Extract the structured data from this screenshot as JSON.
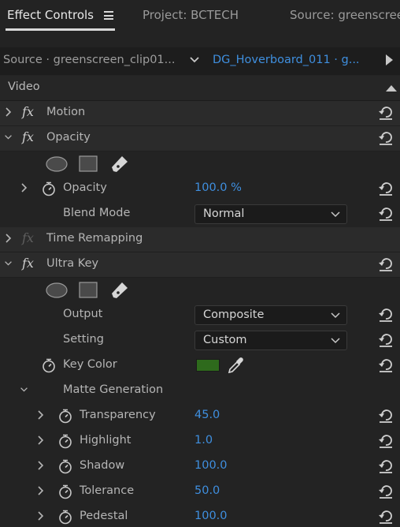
{
  "tabs": {
    "effect_controls": "Effect Controls",
    "project": "Project: BCTECH",
    "source": "Source: greenscree"
  },
  "source_bar": {
    "source": "Source · greenscreen_clip01...",
    "clip": "DG_Hoverboard_011 · g..."
  },
  "video_header": "Video",
  "effects": {
    "motion": "Motion",
    "opacity": {
      "name": "Opacity",
      "prop_opacity_label": "Opacity",
      "prop_opacity_value": "100.0 %",
      "blend_label": "Blend Mode",
      "blend_value": "Normal"
    },
    "time_remapping": "Time Remapping",
    "ultra_key": {
      "name": "Ultra Key",
      "output_label": "Output",
      "output_value": "Composite",
      "setting_label": "Setting",
      "setting_value": "Custom",
      "key_color_label": "Key Color",
      "key_color_hex": "#2e6a1c",
      "matte_generation": "Matte Generation",
      "params": [
        {
          "label": "Transparency",
          "value": "45.0"
        },
        {
          "label": "Highlight",
          "value": "1.0"
        },
        {
          "label": "Shadow",
          "value": "100.0"
        },
        {
          "label": "Tolerance",
          "value": "50.0"
        },
        {
          "label": "Pedestal",
          "value": "100.0"
        }
      ]
    }
  },
  "colors": {
    "accent_blue": "#3f8fdf",
    "panel_bg": "#232323"
  }
}
